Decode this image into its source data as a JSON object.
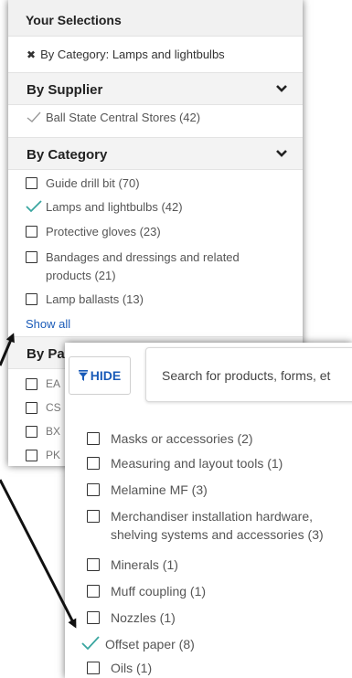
{
  "selections": {
    "title": "Your Selections",
    "active_filter": "By Category: Lamps and lightbulbs"
  },
  "supplier": {
    "title": "By Supplier",
    "items": [
      {
        "label": "Ball State Central Stores (42)",
        "checked": true
      }
    ]
  },
  "category": {
    "title": "By Category",
    "items": [
      {
        "label": "Guide drill bit (70)",
        "checked": false
      },
      {
        "label": "Lamps and lightbulbs (42)",
        "checked": true
      },
      {
        "label": "Protective gloves (23)",
        "checked": false
      },
      {
        "label": "Bandages and dressings and related products (21)",
        "checked": false
      },
      {
        "label": "Lamp ballasts (13)",
        "checked": false
      }
    ],
    "show_all": "Show all"
  },
  "part_section": {
    "title": "By Pa",
    "items": [
      "EA",
      "CS",
      "BX",
      "PK"
    ]
  },
  "toolbar": {
    "hide_label": "HIDE",
    "search_placeholder": "Search for products, forms, et"
  },
  "expanded_category": {
    "items": [
      {
        "label": "Masks or accessories (2)",
        "checked": false
      },
      {
        "label": "Measuring and layout tools (1)",
        "checked": false
      },
      {
        "label": "Melamine MF (3)",
        "checked": false
      },
      {
        "label": "Merchandiser installation hardware, shelving systems and accessories (3)",
        "checked": false
      },
      {
        "label": "Minerals (1)",
        "checked": false
      },
      {
        "label": "Muff coupling (1)",
        "checked": false
      },
      {
        "label": "Nozzles (1)",
        "checked": false
      },
      {
        "label": "Offset paper (8)",
        "checked": true
      },
      {
        "label": "Oils (1)",
        "checked": false
      }
    ]
  },
  "colors": {
    "accent": "#1a5bb8",
    "check": "#3aa6a0"
  }
}
